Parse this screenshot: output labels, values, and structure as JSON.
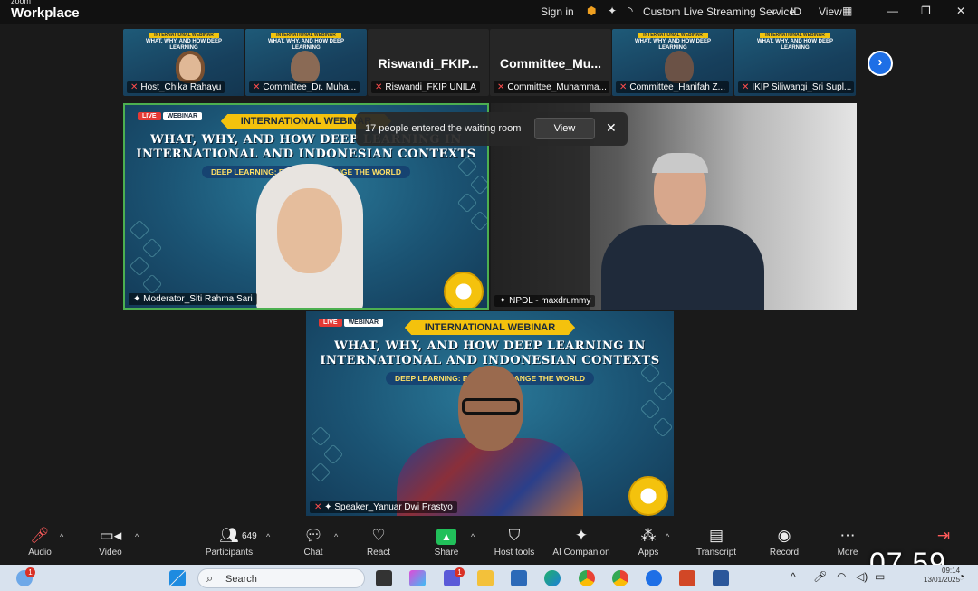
{
  "titlebar": {
    "brand_small": "zoom",
    "brand": "Workplace",
    "sign_in": "Sign in",
    "streaming": "Custom Live Streaming Service",
    "id_label": "ID",
    "view_label": "View",
    "minimize": "—",
    "restore": "❐",
    "close": "✕"
  },
  "strip": [
    {
      "label": "Host_Chika Rahayu"
    },
    {
      "label": "Committee_Dr. Muha..."
    },
    {
      "name_big": "Riswandi_FKIP...",
      "label": "Riswandi_FKIP UNILA"
    },
    {
      "name_big": "Committee_Mu...",
      "label": "Committee_Muhamma..."
    },
    {
      "label": "Committee_Hanifah Z..."
    },
    {
      "label": "IKIP Siliwangi_Sri Supl..."
    }
  ],
  "webinar": {
    "live": "LIVE",
    "tag": "WEBINAR",
    "ribbon": "INTERNATIONAL WEBINAR",
    "title_line1": "WHAT, WHY, AND HOW DEEP LEARNING IN",
    "title_line2": "INTERNATIONAL  AND INDONESIAN CONTEXTS",
    "subtitle": "DEEP LEARNING: ENGAGE · CHANGE THE WORLD"
  },
  "tiles": {
    "moderator": "Moderator_Siti Rahma Sari",
    "npdl": "NPDL - maxdrummy",
    "speaker": "Speaker_Yanuar Dwi Prastyo"
  },
  "waiting": {
    "text": "17 people entered the waiting room",
    "view": "View",
    "close": "✕"
  },
  "toolbar": {
    "audio": "Audio",
    "video": "Video",
    "participants": "Participants",
    "participant_count": "649",
    "chat": "Chat",
    "react": "React",
    "share": "Share",
    "host_tools": "Host tools",
    "ai": "AI Companion",
    "apps": "Apps",
    "transcript": "Transcript",
    "record": "Record",
    "more": "More"
  },
  "overlay_clock": "07.59",
  "taskbar": {
    "search": "Search",
    "time": "09:14",
    "date": "13/01/2025",
    "badge_weather": "1",
    "badge_teams": "1"
  },
  "colors": {
    "accent": "#1e6fe6",
    "share": "#21c05a",
    "ribbon": "#f4c20d",
    "active_border": "#4caf50"
  }
}
